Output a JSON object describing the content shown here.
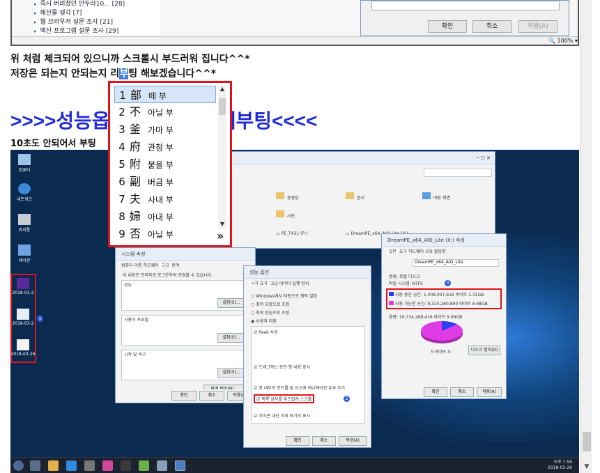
{
  "top_screenshot": {
    "tree_items": [
      "즉시 버려졌던 만두라10... [28]",
      "해산물 생각 [7]",
      "웹 브라우저 설문 조사 [21]",
      "백신 프로그램 설문 조사 [29]"
    ],
    "dialog_buttons": [
      "확인",
      "취소",
      "적용(A)"
    ],
    "zoom": "100%"
  },
  "paragraph": {
    "line1": "위 처럼 체크되어 있으니까 스크롤시 부드러워 집니다^^*",
    "line2_before": "저장은 되는지 안되는지 리",
    "line2_highlight": "부",
    "line2_after": "팅 해보겠습니다^^*",
    "heading_left": ">>>>성능옵",
    "heading_right": "재부팅<<<<",
    "line3": "10초도 안되어서 부팅"
  },
  "ime": {
    "candidates": [
      {
        "num": "1",
        "hanja": "部",
        "reading": "떼 부"
      },
      {
        "num": "2",
        "hanja": "不",
        "reading": "아닐 부"
      },
      {
        "num": "3",
        "hanja": "釜",
        "reading": "가마 부"
      },
      {
        "num": "4",
        "hanja": "府",
        "reading": "관청 부"
      },
      {
        "num": "5",
        "hanja": "附",
        "reading": "붙을 부"
      },
      {
        "num": "6",
        "hanja": "副",
        "reading": "버금 부"
      },
      {
        "num": "7",
        "hanja": "夫",
        "reading": "사내 부"
      },
      {
        "num": "8",
        "hanja": "婦",
        "reading": "아내 부"
      },
      {
        "num": "9",
        "hanja": "否",
        "reading": "아닐 부"
      }
    ],
    "more": "»"
  },
  "desktop": {
    "icons": [
      "컴퓨터",
      "네트워크",
      "휴지통",
      "제어판"
    ],
    "highlighted_icons": [
      "2018-03-2",
      "2018-03-2",
      "2018-03-26"
    ],
    "explorer": {
      "folders": [
        "동영상",
        "문서",
        "바탕 화면",
        "사진"
      ],
      "drives": [
        "PE_T431 (P:)",
        "DreamPE_x64_AIO_Lite (X:)"
      ]
    },
    "system_props": {
      "title": "시스템 속성",
      "tabs": [
        "컴퓨터 이름",
        "하드웨어",
        "고급",
        "원격"
      ],
      "note": "이 내용은 관리자로 로그온하여 변경할 수 있습니다.",
      "perf": "성능",
      "settings": "설정(S)...",
      "profile": "사용자 프로필",
      "startup": "시작 및 복구",
      "env": "환경 변수(N)...",
      "buttons": [
        "확인",
        "취소",
        "적용(A)"
      ]
    },
    "perf_options": {
      "title": "성능 옵션",
      "tabs": [
        "시각 효과",
        "고급",
        "데이터 실행 방지"
      ],
      "options": [
        "Windows에서 자동으로 최적 설정",
        "최적 모양으로 조정",
        "최적 성능으로 조정",
        "사용자 지정",
        "Peek 사용",
        "드래그하는 동안 창 내용 표시",
        "창 내부의 컨트롤 및 요소에 애니메이션 효과 주기",
        "목록 상자를 부드럽게 스크롤",
        "아이콘 대신 미리 보기로 표시"
      ],
      "buttons": [
        "확인",
        "취소",
        "적용(A)"
      ]
    },
    "drive_props": {
      "title": "DreamPE_x64_AIO_Lite (X:) 속성",
      "tabs": [
        "일반",
        "도구",
        "하드웨어",
        "공유",
        "할당량"
      ],
      "name": "DreamPE_x64_AIO_Lite",
      "type_label": "종류:",
      "type_value": "로컬 디스크",
      "fs_label": "파일 시스템:",
      "fs_value": "NTFS",
      "used_label": "사용 중인 공간:",
      "used_bytes": "1,409,007,616 바이트",
      "used_size": "1.31GB",
      "free_label": "사용 가능한 공간:",
      "free_bytes": "9,325,260,800 바이트",
      "free_size": "8.68GB",
      "cap_label": "용량:",
      "cap_bytes": "10,734,268,416 바이트",
      "cap_size": "9.99GB",
      "drive_label": "드라이브 X:",
      "cleanup": "디스크 정리(D)",
      "buttons": [
        "확인",
        "취소",
        "적용(A)"
      ],
      "used_fraction": 0.131
    },
    "badges": [
      "1",
      "2",
      "3"
    ],
    "clock_time": "오후 7:58",
    "clock_date": "2018-03-26"
  },
  "colors": {
    "heading": "#1f2bd6",
    "highlight_box": "#e0121b",
    "used": "#2d3df0",
    "free": "#e03ce6"
  }
}
